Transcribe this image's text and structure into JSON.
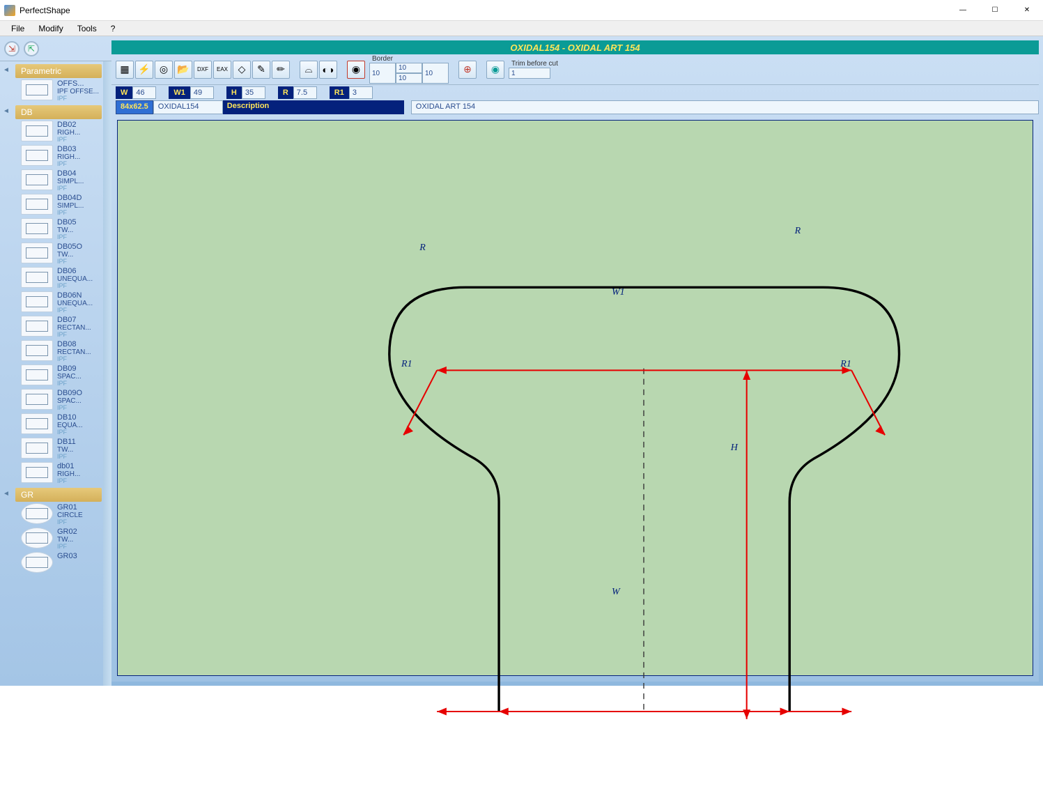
{
  "window": {
    "title": "PerfectShape"
  },
  "menubar": {
    "file": "File",
    "modify": "Modify",
    "tools": "Tools",
    "help": "?"
  },
  "sidebar": {
    "cat_parametric": "Parametric",
    "parametric_item": {
      "code": "OFFS...",
      "desc": "IPF OFFSE...",
      "tag": "IPF"
    },
    "cat_db": "DB",
    "db_items": [
      {
        "code": "DB02",
        "desc": "RIGH...",
        "tag": "IPF"
      },
      {
        "code": "DB03",
        "desc": "RIGH...",
        "tag": "IPF"
      },
      {
        "code": "DB04",
        "desc": "SIMPL...",
        "tag": "IPF"
      },
      {
        "code": "DB04D",
        "desc": "SIMPL...",
        "tag": "IPF"
      },
      {
        "code": "DB05",
        "desc": "TW...",
        "tag": "IPF"
      },
      {
        "code": "DB05O",
        "desc": "TW...",
        "tag": "IPF"
      },
      {
        "code": "DB06",
        "desc": "UNEQUA...",
        "tag": "IPF"
      },
      {
        "code": "DB06N",
        "desc": "UNEQUA...",
        "tag": "IPF"
      },
      {
        "code": "DB07",
        "desc": "RECTAN...",
        "tag": "IPF"
      },
      {
        "code": "DB08",
        "desc": "RECTAN...",
        "tag": "IPF"
      },
      {
        "code": "DB09",
        "desc": "SPAC...",
        "tag": "IPF"
      },
      {
        "code": "DB09O",
        "desc": "SPAC...",
        "tag": "IPF"
      },
      {
        "code": "DB10",
        "desc": "EQUA...",
        "tag": "IPF"
      },
      {
        "code": "DB11",
        "desc": "TW...",
        "tag": "IPF"
      },
      {
        "code": "db01",
        "desc": "RIGH...",
        "tag": "IPF"
      }
    ],
    "cat_gr": "GR",
    "gr_items": [
      {
        "code": "GR01",
        "desc": "CIRCLE",
        "tag": "IPF"
      },
      {
        "code": "GR02",
        "desc": "TW...",
        "tag": "IPF"
      },
      {
        "code": "GR03",
        "desc": "",
        "tag": ""
      }
    ]
  },
  "doc": {
    "title": "OXIDAL154 - OXIDAL ART 154"
  },
  "toolbar": {
    "border_label": "Border",
    "border_left": "10",
    "border_top": "10",
    "border_right": "10",
    "border_bottom": "10",
    "trim_label": "Trim before cut",
    "trim_value": "1"
  },
  "params": {
    "W_label": "W",
    "W": "46",
    "W1_label": "W1",
    "W1": "49",
    "H_label": "H",
    "H": "35",
    "R_label": "R",
    "R": "7.5",
    "R1_label": "R1",
    "R1": "3"
  },
  "info": {
    "size": "84x62.5",
    "name": "OXIDAL154",
    "desc_label": "Description",
    "desc": "OXIDAL ART 154"
  },
  "canvas_labels": {
    "R_left": "R",
    "R_right": "R",
    "R1_left": "R1",
    "R1_right": "R1",
    "W1": "W1",
    "W": "W",
    "H": "H"
  }
}
